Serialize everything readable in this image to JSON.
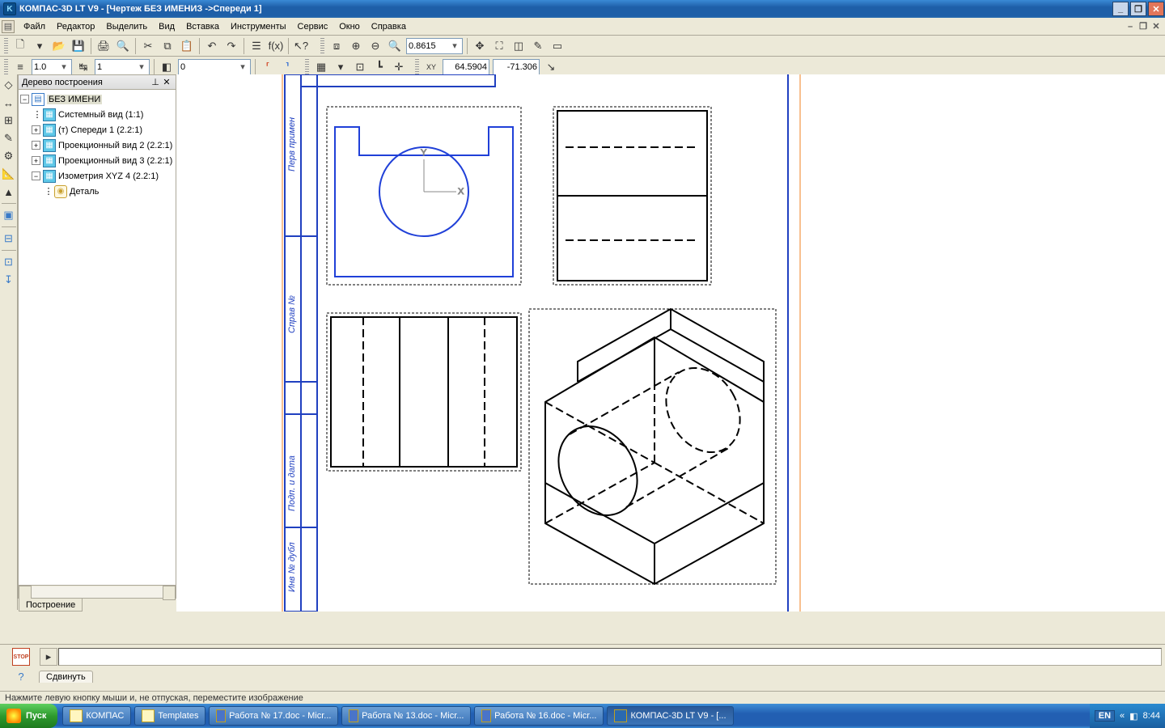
{
  "title": "КОМПАС-3D LT V9 - [Чертеж БЕЗ ИМЕНИЗ ->Спереди 1]",
  "menu": {
    "file": "Файл",
    "editor": "Редактор",
    "select": "Выделить",
    "view": "Вид",
    "insert": "Вставка",
    "tools": "Инструменты",
    "service": "Сервис",
    "window": "Окно",
    "help": "Справка"
  },
  "toolbar1": {
    "zoom_value": "0.8615"
  },
  "toolbar2": {
    "width_value": "1.0",
    "layer_value": "1",
    "style_value": "0",
    "coord_label": "XY",
    "x": "64.5904",
    "y": "-71.306"
  },
  "tree": {
    "title": "Дерево построения",
    "root": "БЕЗ ИМЕНИ",
    "n1": "Системный вид (1:1)",
    "n2": "(т) Спереди 1 (2.2:1)",
    "n3": "Проекционный вид 2 (2.2:1)",
    "n4": "Проекционный вид 3 (2.2:1)",
    "n5": "Изометрия XYZ 4 (2.2:1)",
    "detail": "Деталь",
    "bottom_tab": "Построение"
  },
  "cmd": {
    "stop": "STOP",
    "tab": "Сдвинуть"
  },
  "status": "Нажмите левую кнопку мыши и, не отпуская, переместите изображение",
  "taskbar": {
    "start": "Пуск",
    "b1": "КОМПАС",
    "b2": "Templates",
    "b3": "Работа № 17.doc - Micr...",
    "b4": "Работа № 13.doc - Micr...",
    "b5": "Работа № 16.doc - Micr...",
    "b6": "КОМПАС-3D LT V9 - [...",
    "lang": "EN",
    "time": "8:44",
    "chev": "«"
  },
  "icons": {
    "logo": "K"
  }
}
